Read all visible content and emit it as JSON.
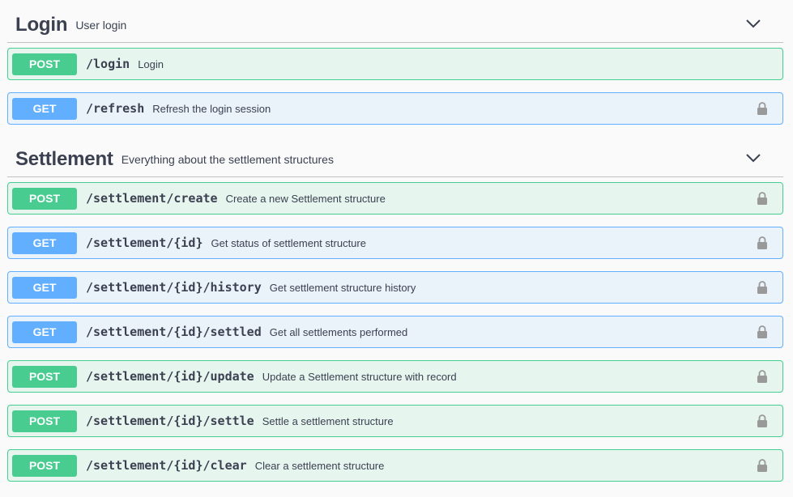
{
  "sections": [
    {
      "title": "Login",
      "description": "User login",
      "operations": [
        {
          "method": "POST",
          "path": "/login",
          "summary": "Login",
          "locked": false
        },
        {
          "method": "GET",
          "path": "/refresh",
          "summary": "Refresh the login session",
          "locked": true
        }
      ]
    },
    {
      "title": "Settlement",
      "description": "Everything about the settlement structures",
      "operations": [
        {
          "method": "POST",
          "path": "/settlement/create",
          "summary": "Create a new Settlement structure",
          "locked": true
        },
        {
          "method": "GET",
          "path": "/settlement/{id}",
          "summary": "Get status of settlement structure",
          "locked": true
        },
        {
          "method": "GET",
          "path": "/settlement/{id}/history",
          "summary": "Get settlement structure history",
          "locked": true
        },
        {
          "method": "GET",
          "path": "/settlement/{id}/settled",
          "summary": "Get all settlements performed",
          "locked": true
        },
        {
          "method": "POST",
          "path": "/settlement/{id}/update",
          "summary": "Update a Settlement structure with record",
          "locked": true
        },
        {
          "method": "POST",
          "path": "/settlement/{id}/settle",
          "summary": "Settle a settlement structure",
          "locked": true
        },
        {
          "method": "POST",
          "path": "/settlement/{id}/clear",
          "summary": "Clear a settlement structure",
          "locked": true
        }
      ]
    }
  ],
  "colors": {
    "post": "#49cc90",
    "get": "#61affe",
    "text": "#3b4151",
    "lock": "#999999"
  },
  "icons": {
    "collapse": "chevron-down-icon",
    "auth": "lock-icon"
  }
}
